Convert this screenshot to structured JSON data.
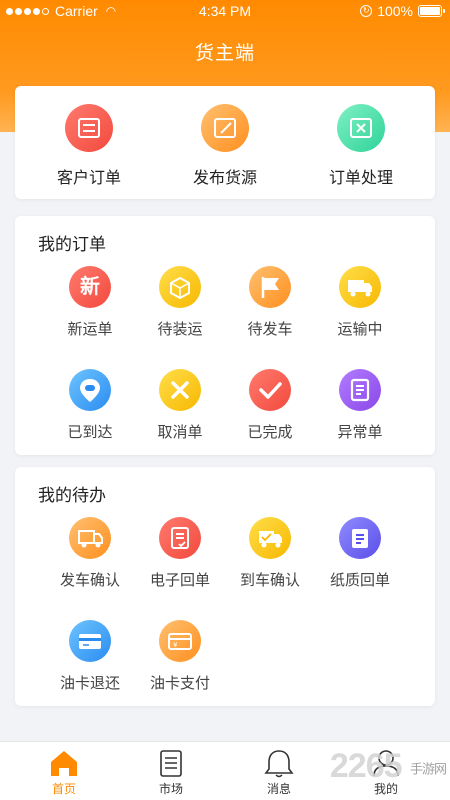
{
  "status_bar": {
    "carrier": "Carrier",
    "time": "4:34 PM",
    "battery": "100%"
  },
  "nav": {
    "title": "货主端"
  },
  "top_actions": [
    {
      "label": "客户订单",
      "icon": "list-icon",
      "color": "#f24a3d"
    },
    {
      "label": "发布货源",
      "icon": "edit-icon",
      "color": "#ff8f1f"
    },
    {
      "label": "订单处理",
      "icon": "x-doc-icon",
      "color": "#2fd39a"
    }
  ],
  "orders": {
    "title": "我的订单",
    "items": [
      {
        "label": "新运单",
        "icon": "new-icon",
        "glyph": "新"
      },
      {
        "label": "待装运",
        "icon": "box-icon"
      },
      {
        "label": "待发车",
        "icon": "flag-icon"
      },
      {
        "label": "运输中",
        "icon": "truck-icon"
      },
      {
        "label": "已到达",
        "icon": "location-icon"
      },
      {
        "label": "取消单",
        "icon": "cancel-icon"
      },
      {
        "label": "已完成",
        "icon": "check-icon"
      },
      {
        "label": "异常单",
        "icon": "doc-icon"
      }
    ]
  },
  "todo": {
    "title": "我的待办",
    "items": [
      {
        "label": "发车确认",
        "icon": "depart-truck-icon"
      },
      {
        "label": "电子回单",
        "icon": "e-receipt-icon"
      },
      {
        "label": "到车确认",
        "icon": "arrive-truck-icon"
      },
      {
        "label": "纸质回单",
        "icon": "paper-receipt-icon"
      },
      {
        "label": "油卡退还",
        "icon": "card-icon"
      },
      {
        "label": "油卡支付",
        "icon": "card-pay-icon"
      }
    ]
  },
  "tabbar": {
    "tabs": [
      {
        "label": "首页",
        "icon": "home-icon",
        "active": true
      },
      {
        "label": "市场",
        "icon": "market-icon",
        "active": false
      },
      {
        "label": "消息",
        "icon": "bell-icon",
        "active": false
      },
      {
        "label": "我的",
        "icon": "user-icon",
        "active": false
      }
    ]
  },
  "watermark": {
    "text": "2265",
    "sub": "手游网"
  },
  "colors": {
    "accent": "#ff8a00",
    "background": "#f2f3f7"
  }
}
